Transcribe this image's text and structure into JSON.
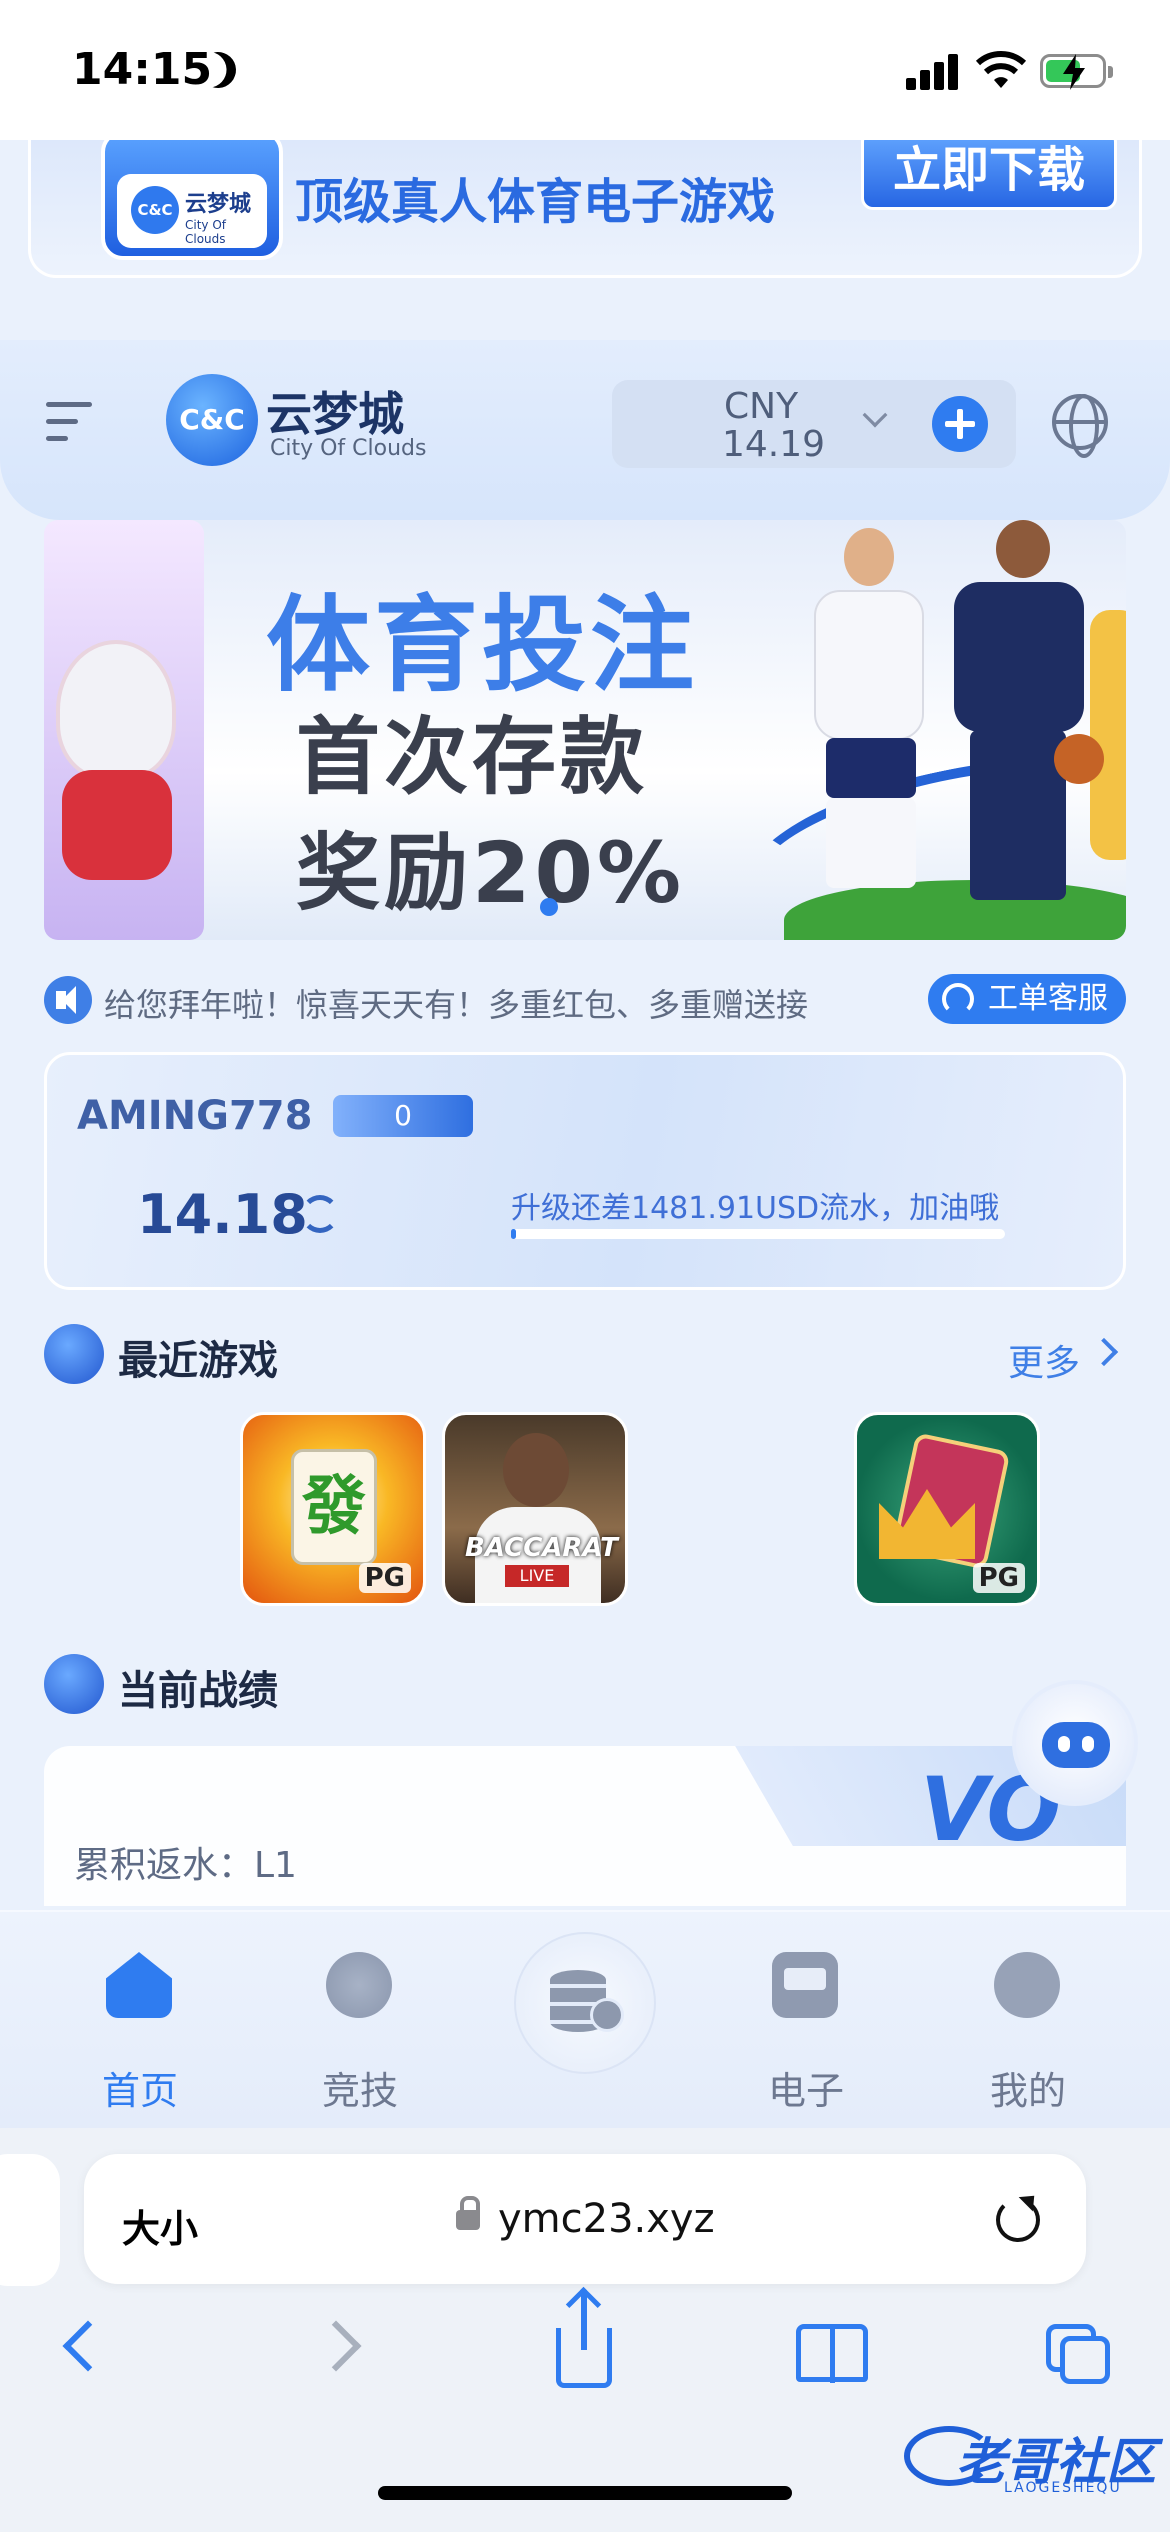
{
  "status_bar": {
    "time": "14:15"
  },
  "download_banner": {
    "logo_name": "云梦城",
    "logo_en": "City Of Clouds",
    "logo_mark": "C&C",
    "tagline": "顶级真人体育电子游戏",
    "button_label": "立即下载"
  },
  "header": {
    "logo_mark": "C&C",
    "logo_name": "云梦城",
    "logo_en": "City Of Clouds",
    "currency": "CNY",
    "balance": "14.19"
  },
  "promo": {
    "line1": "体育投注",
    "line2": "首次存款",
    "line3": "奖励20%"
  },
  "marquee": {
    "text": "给您拜年啦！惊喜天天有！多重红包、多重赠送接",
    "service_label": "工单客服"
  },
  "account": {
    "username": "AMING778",
    "level": "0",
    "balance": "14.18",
    "upgrade_text": "升级还差1481.91USD流水，加油哦",
    "upgrade_progress": 0.01
  },
  "recent_games": {
    "title": "最近游戏",
    "more_label": "更多",
    "games": [
      {
        "name": "mahjong-pg",
        "tile_char": "發",
        "provider": "PG"
      },
      {
        "name": "baccarat-live",
        "caption": "BACCARAT",
        "badge": "LIVE"
      },
      {
        "name": "royal-cards-pg",
        "provider": "PG"
      }
    ]
  },
  "stats": {
    "title": "当前战绩",
    "rebate_label": "累积返水：L1",
    "vip_text": "VO"
  },
  "tabbar": {
    "items": [
      {
        "label": "首页",
        "active": true
      },
      {
        "label": "竞技"
      },
      {
        "label": ""
      },
      {
        "label": "电子"
      },
      {
        "label": "我的"
      }
    ]
  },
  "browser": {
    "text_size_label": "大小",
    "url": "ymc23.xyz"
  },
  "watermark": {
    "text": "老哥社区",
    "sub": "LAOGESHEQU"
  },
  "colors": {
    "accent": "#2f7cf0",
    "background": "#eaf1fc"
  }
}
